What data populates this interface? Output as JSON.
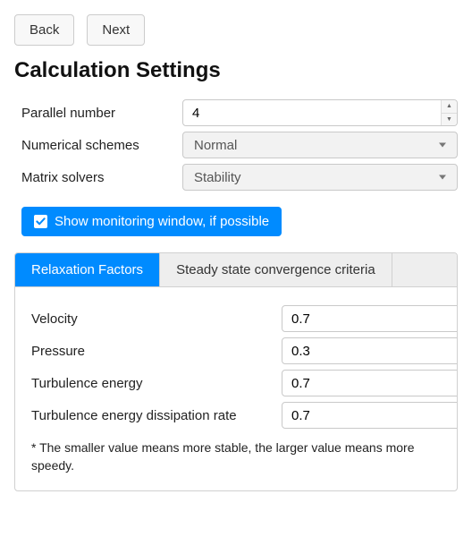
{
  "nav": {
    "back": "Back",
    "next": "Next"
  },
  "title": "Calculation Settings",
  "fields": {
    "parallel_label": "Parallel number",
    "parallel_value": "4",
    "numerical_label": "Numerical schemes",
    "numerical_value": "Normal",
    "matrix_label": "Matrix solvers",
    "matrix_value": "Stability"
  },
  "monitoring": {
    "label": "Show monitoring window, if possible",
    "checked": true
  },
  "tabs": {
    "relaxation": "Relaxation Factors",
    "convergence": "Steady state convergence criteria"
  },
  "relaxation": {
    "velocity_label": "Velocity",
    "velocity_value": "0.7",
    "pressure_label": "Pressure",
    "pressure_value": "0.3",
    "tke_label": "Turbulence energy",
    "tke_value": "0.7",
    "tde_label": "Turbulence energy dissipation rate",
    "tde_value": "0.7",
    "note": "* The smaller value means more stable, the larger value means more speedy."
  }
}
